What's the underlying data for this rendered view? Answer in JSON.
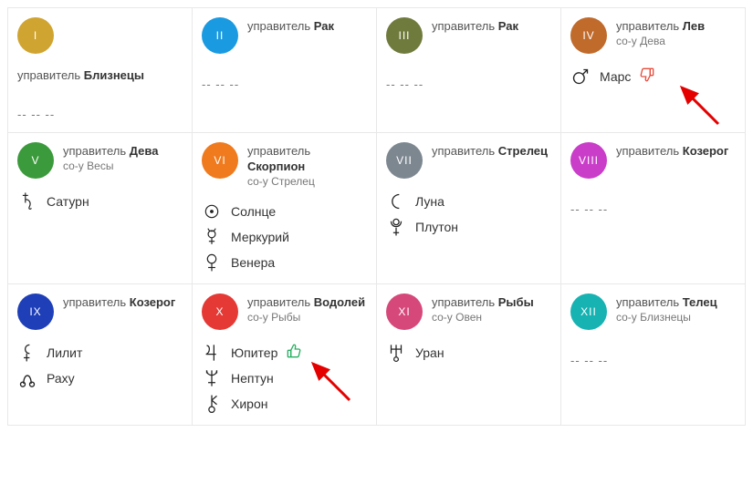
{
  "labels": {
    "ruler": "управитель",
    "co_ruler_prefix": "со-у",
    "dashes": "-- -- --"
  },
  "houses": [
    {
      "num": "I",
      "color": "#d0a430",
      "ruler": "Близнецы",
      "co_ruler": null,
      "stacked": true,
      "planets": [],
      "empty": true
    },
    {
      "num": "II",
      "color": "#1a9ae1",
      "ruler": "Рак",
      "co_ruler": null,
      "stacked": false,
      "planets": [],
      "empty": true
    },
    {
      "num": "III",
      "color": "#6f7a3d",
      "ruler": "Рак",
      "co_ruler": null,
      "stacked": false,
      "planets": [],
      "empty": true
    },
    {
      "num": "IV",
      "color": "#c06a2b",
      "ruler": "Лев",
      "co_ruler": "Дева",
      "stacked": false,
      "planets": [
        {
          "glyph": "mars",
          "name": "Марс",
          "thumb": "down"
        }
      ],
      "empty": false,
      "arrow": true
    },
    {
      "num": "V",
      "color": "#3b9a3b",
      "ruler": "Дева",
      "co_ruler": "Весы",
      "stacked": false,
      "planets": [
        {
          "glyph": "saturn",
          "name": "Сатурн"
        }
      ],
      "empty": false
    },
    {
      "num": "VI",
      "color": "#f07a1e",
      "ruler": "Скорпион",
      "co_ruler": "Стрелец",
      "stacked": false,
      "planets": [
        {
          "glyph": "sun",
          "name": "Солнце"
        },
        {
          "glyph": "mercury",
          "name": "Меркурий"
        },
        {
          "glyph": "venus",
          "name": "Венера"
        }
      ],
      "empty": false
    },
    {
      "num": "VII",
      "color": "#7d8790",
      "ruler": "Стрелец",
      "co_ruler": null,
      "stacked": false,
      "planets": [
        {
          "glyph": "moon",
          "name": "Луна"
        },
        {
          "glyph": "pluto",
          "name": "Плутон"
        }
      ],
      "empty": false
    },
    {
      "num": "VIII",
      "color": "#c93dc9",
      "ruler": "Козерог",
      "co_ruler": null,
      "stacked": false,
      "planets": [],
      "empty": true
    },
    {
      "num": "IX",
      "color": "#1e3fb8",
      "ruler": "Козерог",
      "co_ruler": null,
      "stacked": false,
      "planets": [
        {
          "glyph": "lilith",
          "name": "Лилит"
        },
        {
          "glyph": "rahu",
          "name": "Раху"
        }
      ],
      "empty": false
    },
    {
      "num": "X",
      "color": "#e53935",
      "ruler": "Водолей",
      "co_ruler": "Рыбы",
      "stacked": false,
      "planets": [
        {
          "glyph": "jupiter",
          "name": "Юпитер",
          "thumb": "up"
        },
        {
          "glyph": "neptune",
          "name": "Нептун"
        },
        {
          "glyph": "chiron",
          "name": "Хирон"
        }
      ],
      "empty": false,
      "arrow": true
    },
    {
      "num": "XI",
      "color": "#d6487a",
      "ruler": "Рыбы",
      "co_ruler": "Овен",
      "stacked": false,
      "planets": [
        {
          "glyph": "uranus",
          "name": "Уран"
        }
      ],
      "empty": false
    },
    {
      "num": "XII",
      "color": "#17b2b2",
      "ruler": "Телец",
      "co_ruler": "Близнецы",
      "stacked": false,
      "planets": [],
      "empty": true
    }
  ]
}
